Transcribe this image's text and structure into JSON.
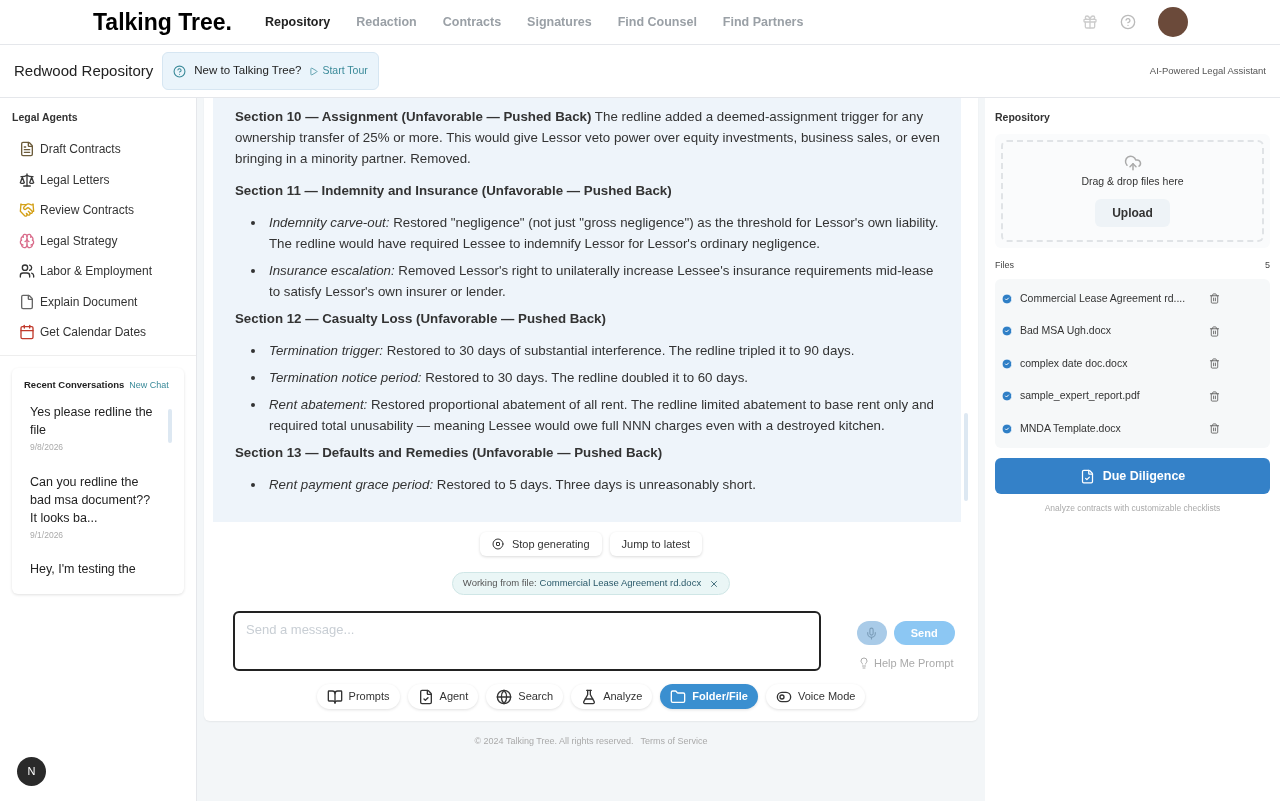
{
  "header": {
    "logo": "Talking Tree.",
    "nav": [
      {
        "label": "Repository",
        "selected": true
      },
      {
        "label": "Redaction",
        "selected": false
      },
      {
        "label": "Contracts",
        "selected": false
      },
      {
        "label": "Signatures",
        "selected": false
      },
      {
        "label": "Find Counsel",
        "selected": false
      },
      {
        "label": "Find Partners",
        "selected": false
      }
    ]
  },
  "subheader": {
    "title": "Redwood Repository",
    "tour_prompt": "New to Talking Tree?",
    "tour_link": "Start Tour",
    "tagline": "AI-Powered Legal Assistant"
  },
  "sidebar": {
    "title": "Legal Agents",
    "items": [
      {
        "label": "Draft Contracts",
        "kind": "memo"
      },
      {
        "label": "Legal Letters",
        "kind": "scales"
      },
      {
        "label": "Review Contracts",
        "kind": "handshake"
      },
      {
        "label": "Legal Strategy",
        "kind": "brain"
      },
      {
        "label": "Labor & Employment",
        "kind": "people"
      },
      {
        "label": "Explain Document",
        "kind": "page"
      },
      {
        "label": "Get Calendar Dates",
        "kind": "calendar"
      }
    ],
    "recent": {
      "title": "Recent Conversations",
      "new_chat": "New Chat",
      "items": [
        {
          "title": "Yes please redline the file",
          "date": "9/8/2026"
        },
        {
          "title": "Can you redline the bad msa document?? It looks ba...",
          "date": "9/1/2026"
        },
        {
          "title": "Hey, I'm testing the"
        }
      ]
    }
  },
  "chat": {
    "blocks": [
      {
        "kind": "paragraph",
        "text": "**Section 10 — Assignment (Unfavorable — Pushed Back)** The redline added a deemed-assignment trigger for any ownership transfer of 25% or more. This would give Lessor veto power over equity investments, business sales, or even bringing in a minority partner. Removed."
      },
      {
        "kind": "heading",
        "text": "Section 11 — Indemnity and Insurance (Unfavorable — Pushed Back)"
      },
      {
        "kind": "bullet",
        "text": "*Indemnity carve-out:* Restored \"negligence\" (not just \"gross negligence\") as the threshold for Lessor's own liability. The redline would have required Lessee to indemnify Lessor for Lessor's ordinary negligence."
      },
      {
        "kind": "bullet",
        "text": "*Insurance escalation:* Removed Lessor's right to unilaterally increase Lessee's insurance requirements mid-lease to satisfy Lessor's own insurer or lender."
      },
      {
        "kind": "heading",
        "text": "Section 12 — Casualty Loss (Unfavorable — Pushed Back)"
      },
      {
        "kind": "bullet",
        "text": "*Termination trigger:* Restored to 30 days of substantial interference. The redline tripled it to 90 days."
      },
      {
        "kind": "bullet",
        "text": "*Termination notice period:* Restored to 30 days. The redline doubled it to 60 days."
      },
      {
        "kind": "bullet",
        "text": "*Rent abatement:* Restored proportional abatement of all rent. The redline limited abatement to base rent only and required total unusability — meaning Lessee would owe full NNN charges even with a destroyed kitchen."
      },
      {
        "kind": "heading",
        "text": "Section 13 — Defaults and Remedies (Unfavorable — Pushed Back)"
      },
      {
        "kind": "bullet",
        "text": "*Rent payment grace period:* Restored to 5 days. Three days is unreasonably short."
      }
    ],
    "stop_button": "Stop generating",
    "jump_button": "Jump to latest",
    "file_chip": {
      "label": "Working from file:",
      "file": "Commercial Lease Agreement rd.docx"
    },
    "input": {
      "placeholder": "Send a message..."
    },
    "send": {
      "label": "Send",
      "disabled": true
    },
    "help_prompt": "Help Me Prompt",
    "tools": [
      {
        "label": "Prompts",
        "kind": "book",
        "selected": false
      },
      {
        "label": "Agent",
        "kind": "agent",
        "selected": false
      },
      {
        "label": "Search",
        "kind": "globe",
        "selected": false
      },
      {
        "label": "Analyze",
        "kind": "flask",
        "selected": false
      },
      {
        "label": "Folder/File",
        "kind": "folder",
        "selected": true
      },
      {
        "label": "Voice Mode",
        "kind": "toggle",
        "selected": false
      }
    ],
    "footer": {
      "copyright": "© 2024 Talking Tree. All rights reserved.",
      "terms": "Terms of Service"
    }
  },
  "repository": {
    "title": "Repository",
    "dropzone": "Drag & drop files here",
    "upload": "Upload",
    "files_label": "Files",
    "files_count": "5",
    "files": [
      {
        "name": "Commercial Lease Agreement rd....",
        "checked": true
      },
      {
        "name": "Bad MSA Ugh.docx",
        "checked": true
      },
      {
        "name": "complex date doc.docx",
        "checked": true
      },
      {
        "name": "sample_expert_report.pdf",
        "checked": true
      },
      {
        "name": "MNDA Template.docx",
        "checked": true
      }
    ],
    "due_diligence": "Due Diligence",
    "due_caption": "Analyze contracts with customizable checklists"
  },
  "badge": "N"
}
